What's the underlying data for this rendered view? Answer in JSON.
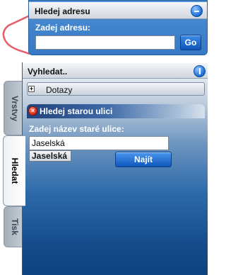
{
  "address_panel": {
    "title": "Hledej adresu",
    "label": "Zadej adresu:",
    "input_value": "",
    "go_label": "Go"
  },
  "search_panel": {
    "title": "Vyhledat..",
    "queries_label": "Dotazy",
    "queries_expander": "+",
    "old_street": {
      "title": "Hledej starou ulici",
      "close_glyph": "×",
      "label": "Zadej název staré ulice:",
      "input_value": "Jaselská",
      "suggestion": "Jaselská",
      "find_label": "Najít"
    }
  },
  "tabs": [
    {
      "label": "Vrstvy",
      "active": false
    },
    {
      "label": "Hledat",
      "active": true
    },
    {
      "label": "Tisk",
      "active": false
    }
  ],
  "colors": {
    "panel_blue": "#3578c4",
    "button_blue": "#0e56bb",
    "close_red": "#d42a17",
    "route_red": "#e85c6a"
  }
}
